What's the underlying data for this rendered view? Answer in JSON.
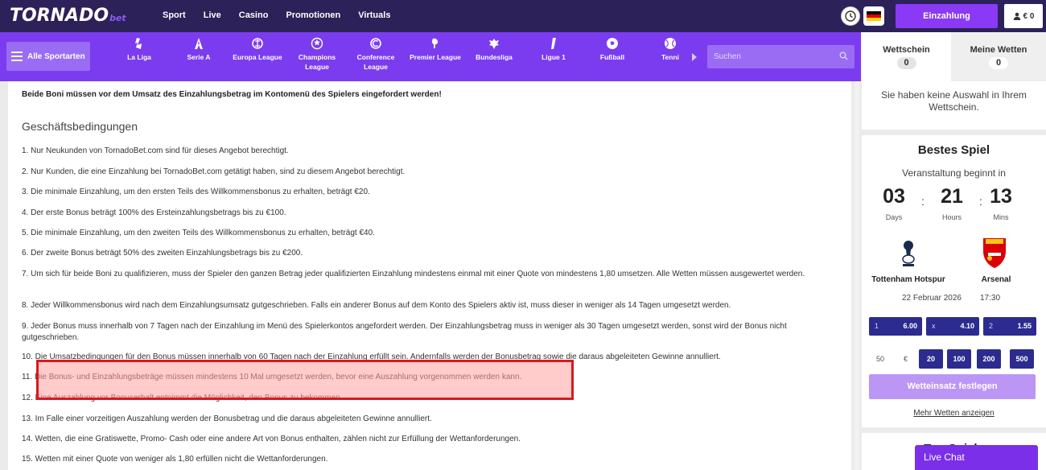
{
  "brand": {
    "name": "TORNADO",
    "suffix": "bet"
  },
  "topnav": [
    "Sport",
    "Live",
    "Casino",
    "Promotionen",
    "Virtuals"
  ],
  "header": {
    "deposit_label": "Einzahlung",
    "balance": "€ 0"
  },
  "sportsbar": {
    "all_sports_label": "Alle Sportarten",
    "items": [
      {
        "label": "La Liga",
        "icon": "laliga-icon"
      },
      {
        "label": "Serie A",
        "icon": "serie-a-icon"
      },
      {
        "label": "Europa League",
        "icon": "europa-league-icon"
      },
      {
        "label": "Champions League",
        "icon": "champions-league-icon"
      },
      {
        "label": "Conference League",
        "icon": "conference-league-icon"
      },
      {
        "label": "Premier League",
        "icon": "premier-league-icon"
      },
      {
        "label": "Bundesliga",
        "icon": "bundesliga-icon"
      },
      {
        "label": "Ligue 1",
        "icon": "ligue1-icon"
      },
      {
        "label": "Fußball",
        "icon": "football-icon"
      },
      {
        "label": "Tenni",
        "icon": "tennis-icon"
      }
    ],
    "search_placeholder": "Suchen"
  },
  "content": {
    "notice": "Beide Boni müssen vor dem Umsatz des Einzahlungsbetrag im Kontomenü des Spielers eingefordert werden!",
    "section_title": "Geschäftsbedingungen",
    "terms": [
      "1. Nur Neukunden von TornadoBet.com sind für dieses Angebot berechtigt.",
      "2. Nur Kunden, die eine Einzahlung bei TornadoBet.com getätigt haben, sind zu diesem Angebot berechtigt.",
      "3. Die minimale Einzahlung, um den ersten Teils des Willkommensbonus zu erhalten, beträgt €20.",
      "4. Der erste Bonus beträgt 100% des Ersteinzahlungsbetrags bis zu €100.",
      "5. Die minimale Einzahlung, um den zweiten Teils des Willkommensbonus zu erhalten, beträgt €40.",
      "6. Der zweite Bonus beträgt 50% des zweiten Einzahlungsbetrags bis zu €200.",
      "7. Um sich für beide Boni zu qualifizieren, muss der Spieler den ganzen Betrag jeder qualifizierten Einzahlung mindestens einmal mit einer Quote von mindestens 1,80 umsetzen. Alle Wetten müssen ausgewertet werden.",
      "8. Jeder Willkommensbonus wird nach dem Einzahlungsumsatz gutgeschrieben. Falls ein anderer Bonus auf dem Konto des Spielers aktiv ist, muss dieser in weniger als 14 Tagen umgesetzt werden.",
      "9. Jeder Bonus muss innerhalb von 7 Tagen nach der Einzahlung im Menü des Spielerkontos angefordert werden. Der Einzahlungsbetrag muss in weniger als 30 Tagen umgesetzt werden, sonst wird der Bonus nicht gutgeschrieben.",
      "10. Die Umsatzbedingungen für den Bonus müssen innerhalb von 60 Tagen nach der Einzahlung erfüllt sein. Andernfalls werden der Bonusbetrag sowie die daraus abgeleiteten Gewinne annulliert.",
      "11. Die Bonus- und Einzahlungsbeträge müssen mindestens 10 Mal umgesetzt werden, bevor eine Auszahlung vorgenommen werden kann.",
      "12. Eine Auszahlung vor Bonuserhalt entnimmt die Möglichkeit, den Bonus zu bekommen.",
      "13. Im Falle einer vorzeitigen Auszahlung werden der Bonusbetrag und die daraus abgeleiteten Gewinne annulliert.",
      "14. Wetten, die eine Gratiswette, Promo- Cash oder eine andere Art von Bonus enthalten, zählen nicht zur Erfüllung der Wettanforderungen.",
      "15. Wetten mit einer Quote von weniger als 1,80 erfüllen nicht die Wettanforderungen."
    ]
  },
  "betslip": {
    "tab_slip": "Wettschein",
    "tab_slip_count": "0",
    "tab_mybets": "Meine Wetten",
    "tab_mybets_count": "0",
    "empty_message": "Sie haben keine Auswahl in Ihrem Wettschein."
  },
  "best_game": {
    "title": "Bestes Spiel",
    "starts_in": "Veranstaltung beginnt in",
    "countdown": [
      {
        "value": "03",
        "unit": "Days"
      },
      {
        "value": "21",
        "unit": "Hours"
      },
      {
        "value": "13",
        "unit": "Mins"
      }
    ],
    "home": "Tottenham Hotspur",
    "away": "Arsenal",
    "date": "22 Februar 2026",
    "time": "17:30",
    "odds": [
      {
        "label": "1",
        "value": "6.00"
      },
      {
        "label": "x",
        "value": "4.10"
      },
      {
        "label": "2",
        "value": "1.55"
      }
    ],
    "stake_amount": "50",
    "stake_currency": "€",
    "chips": [
      "20",
      "100",
      "200",
      "500"
    ],
    "place_bet_label": "Wetteinsatz festlegen",
    "more_bets_label": "Mehr Wetten anzeigen"
  },
  "top_games": {
    "title": "Top Spiele"
  },
  "live_chat_label": "Live Chat",
  "colors": {
    "header": "#2c2158",
    "accent": "#7b3cf0",
    "button": "#8a39f5",
    "odds": "#2c2b8f",
    "highlight_border": "#d8191f"
  }
}
